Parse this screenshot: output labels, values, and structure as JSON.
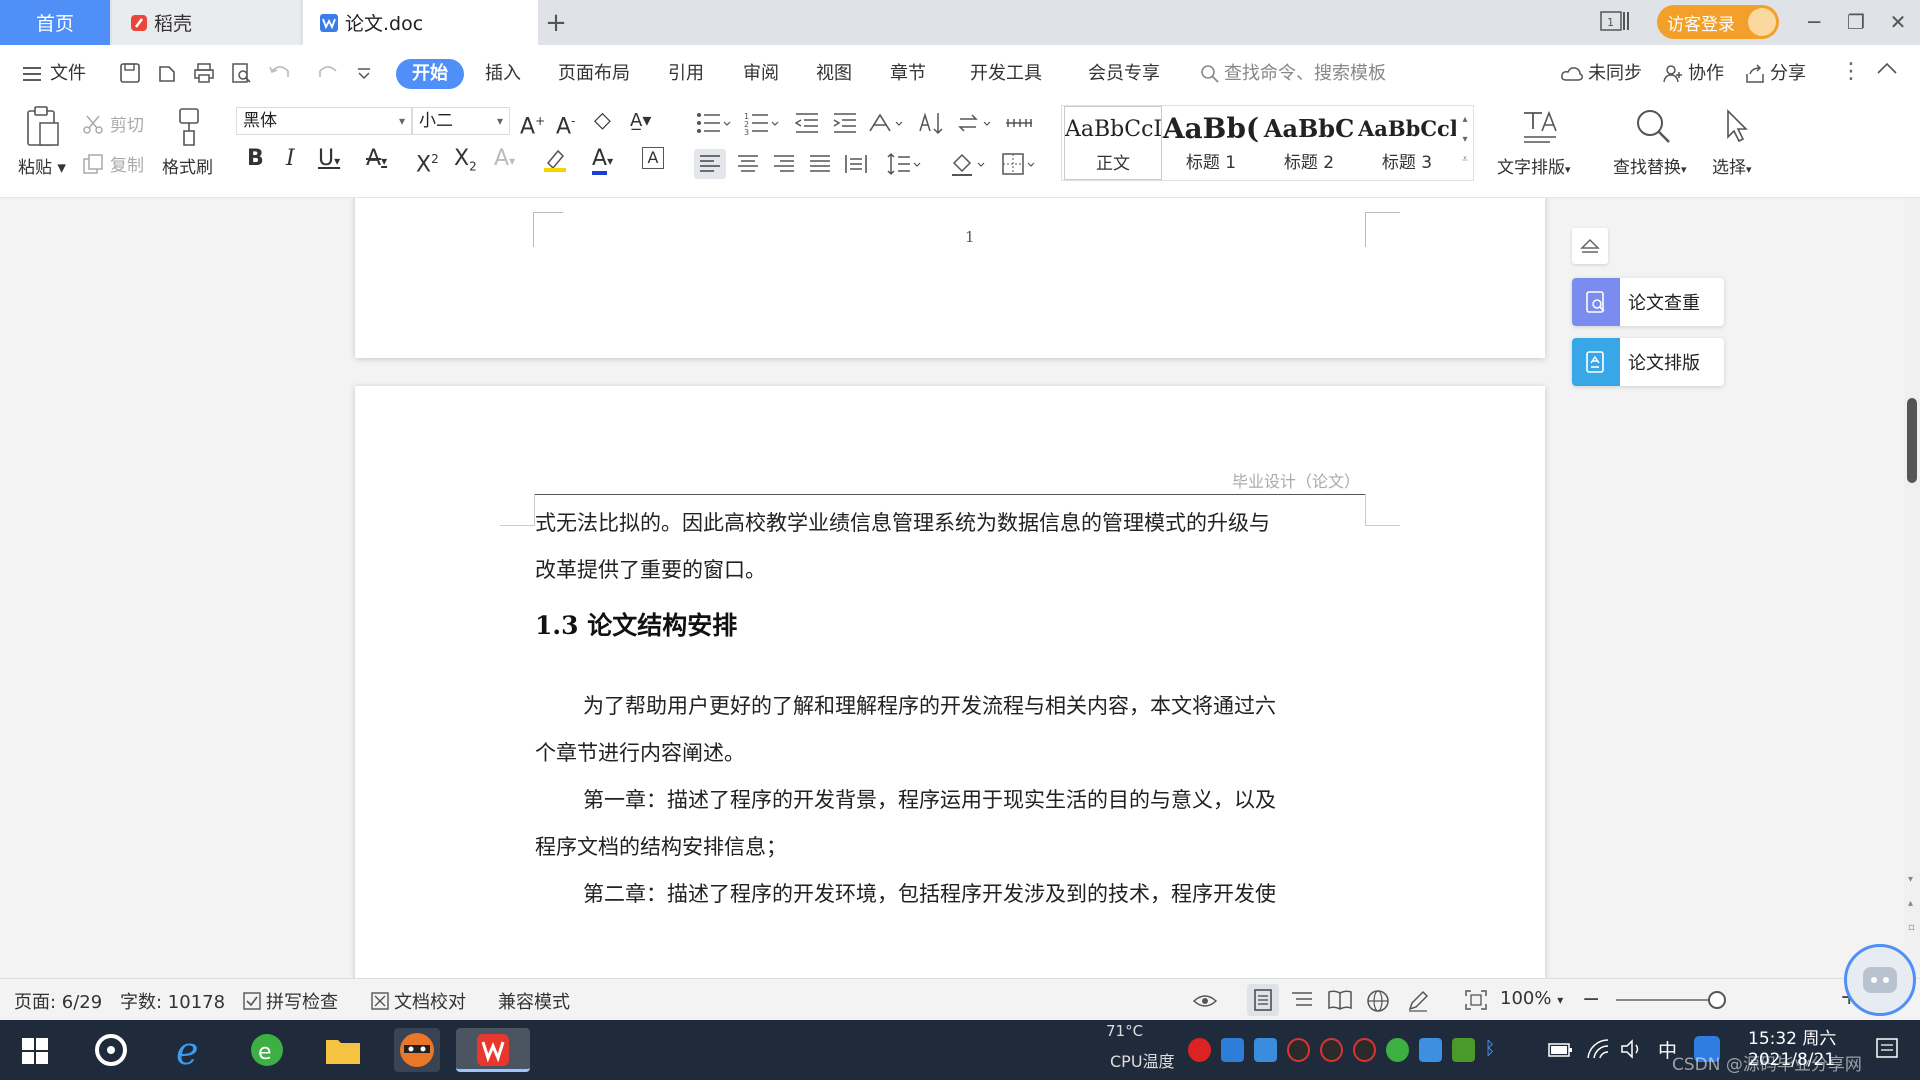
{
  "tabs": {
    "home": "首页",
    "daoke": "稻壳",
    "doc": "论文.doc"
  },
  "titlebar": {
    "login": "访客登录"
  },
  "menu": {
    "file": "文件",
    "items": [
      "开始",
      "插入",
      "页面布局",
      "引用",
      "审阅",
      "视图",
      "章节",
      "开发工具",
      "会员专享"
    ],
    "search_placeholder": "查找命令、搜索模板",
    "unsync": "未同步",
    "collab": "协作",
    "share": "分享"
  },
  "ribbon": {
    "paste": "粘贴",
    "cut": "剪切",
    "copy": "复制",
    "format_painter": "格式刷",
    "font_name": "黑体",
    "font_size": "小二",
    "styles": [
      {
        "preview": "AaBbCcI",
        "name": "正文"
      },
      {
        "preview": "AaBb(",
        "name": "标题 1"
      },
      {
        "preview": "AaBbC",
        "name": "标题 2"
      },
      {
        "preview": "AaBbCcl",
        "name": "标题 3"
      }
    ],
    "text_layout": "文字排版",
    "find_replace": "查找替换",
    "select": "选择"
  },
  "document": {
    "page_number": "1",
    "header": "毕业设计（论文）",
    "line1": "式无法比拟的。因此高校教学业绩信息管理系统为数据信息的管理模式的升级与",
    "line2": "改革提供了重要的窗口。",
    "section_title": "1.3  论文结构安排",
    "para1_line1": "为了帮助用户更好的了解和理解程序的开发流程与相关内容，本文将通过六",
    "para1_line2": "个章节进行内容阐述。",
    "para2_line1": "第一章：描述了程序的开发背景，程序运用于现实生活的目的与意义，以及",
    "para2_line2": "程序文档的结构安排信息；",
    "para3_line1": "第二章：描述了程序的开发环境，包括程序开发涉及到的技术，程序开发使"
  },
  "sidepanel": {
    "check": "论文查重",
    "layout": "论文排版"
  },
  "status": {
    "page": "页面: 6/29",
    "words": "字数: 10178",
    "spell": "拼写检查",
    "proof": "文档校对",
    "compat": "兼容模式",
    "zoom": "100%"
  },
  "taskbar": {
    "temp": "71°C",
    "temp_label": "CPU温度",
    "ime": "中",
    "time": "15:32 周六",
    "date": "2021/8/21",
    "watermark": "CSDN @源码毕业分享网"
  },
  "colors": {
    "accent": "#4f8ff7",
    "login": "#f2a02a",
    "taskbar": "#1f2a3a"
  }
}
